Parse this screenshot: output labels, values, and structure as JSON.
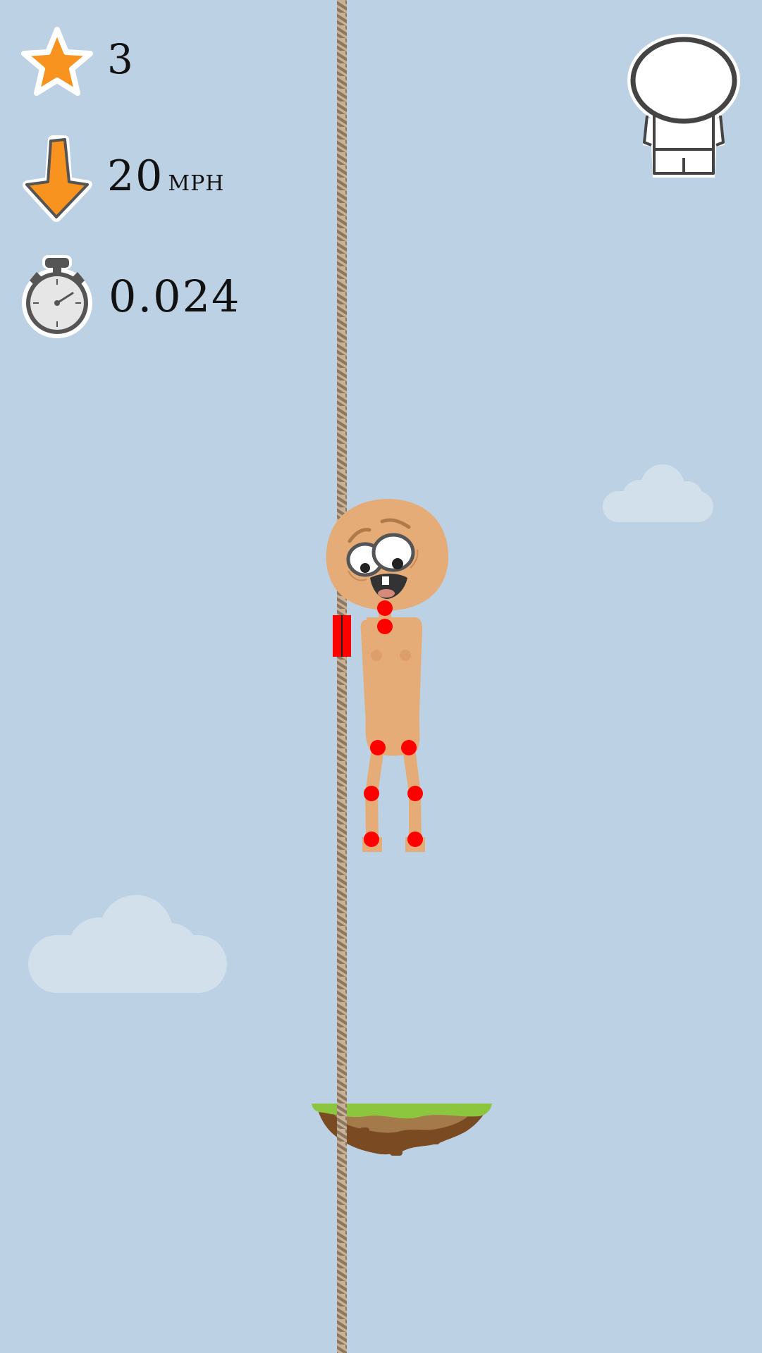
{
  "hud": {
    "stars": {
      "icon": "star-icon",
      "value": "3"
    },
    "speed": {
      "icon": "down-arrow-icon",
      "value": "20",
      "unit": "MPH"
    },
    "timer": {
      "icon": "stopwatch-icon",
      "value": "0.024"
    }
  },
  "character_select": {
    "icon": "character-avatar-icon"
  },
  "colors": {
    "sky": "#bcd2e4",
    "cloud": "#d2e0ec",
    "rope_light": "#c9b195",
    "rope_dark": "#8c7763",
    "skin": "#e5ac78",
    "joint": "#ff0000",
    "hud_orange": "#f7931e",
    "grass": "#8cc63f",
    "dirt": "#8a5a2b"
  }
}
